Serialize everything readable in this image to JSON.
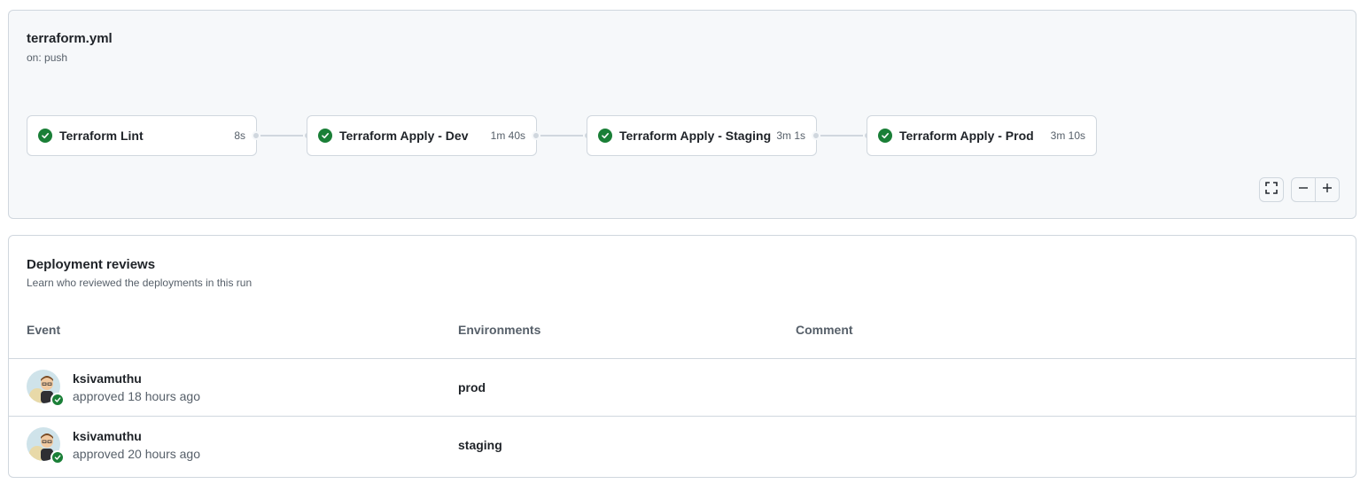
{
  "workflow": {
    "title": "terraform.yml",
    "trigger": "on: push",
    "jobs": [
      {
        "name": "Terraform Lint",
        "duration": "8s",
        "status": "success",
        "icon": "check-circle-icon"
      },
      {
        "name": "Terraform Apply - Dev",
        "duration": "1m 40s",
        "status": "success",
        "icon": "check-circle-icon"
      },
      {
        "name": "Terraform Apply - Staging",
        "duration": "3m 1s",
        "status": "success",
        "icon": "check-circle-icon"
      },
      {
        "name": "Terraform Apply - Prod",
        "duration": "3m 10s",
        "status": "success",
        "icon": "check-circle-icon"
      }
    ],
    "controls": {
      "fullscreen_icon": "fullscreen-icon",
      "zoom_out_icon": "minus-icon",
      "zoom_in_icon": "plus-icon"
    }
  },
  "reviews": {
    "title": "Deployment reviews",
    "subtitle": "Learn who reviewed the deployments in this run",
    "columns": {
      "event": "Event",
      "environments": "Environments",
      "comment": "Comment"
    },
    "rows": [
      {
        "user": "ksivamuthu",
        "action": "approved 18 hours ago",
        "environment": "prod",
        "comment": ""
      },
      {
        "user": "ksivamuthu",
        "action": "approved 20 hours ago",
        "environment": "staging",
        "comment": ""
      }
    ]
  },
  "colors": {
    "success": "#1a7f37",
    "border": "#d0d7de",
    "panel_bg": "#f6f8fa",
    "muted_text": "#57606a"
  }
}
